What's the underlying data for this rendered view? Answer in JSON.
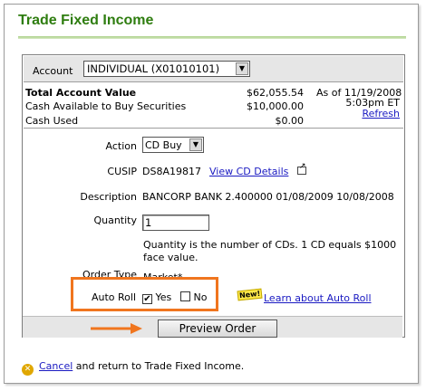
{
  "page": {
    "title": "Trade Fixed Income"
  },
  "account": {
    "label": "Account",
    "selected": "INDIVIDUAL (X01010101)"
  },
  "summary": {
    "total_label": "Total Account Value",
    "total_value": "$62,055.54",
    "cash_available_label": "Cash Available to Buy Securities",
    "cash_available_value": "$10,000.00",
    "cash_used_label": "Cash Used",
    "cash_used_value": "$0.00",
    "as_of": "As of 11/19/2008",
    "as_of_time": "5:03pm ET",
    "refresh_link": "Refresh"
  },
  "order": {
    "action_label": "Action",
    "action_value": "CD Buy",
    "cusip_label": "CUSIP",
    "cusip_value": "DS8A19817",
    "cusip_link": "View CD Details",
    "description_label": "Description",
    "description_value": "BANCORP BANK 2.400000 01/08/2009 10/08/2008",
    "quantity_label": "Quantity",
    "quantity_value": "1",
    "quantity_note_line1": "Quantity is the number of CDs. 1 CD equals $1000",
    "quantity_note_line2": "face value.",
    "order_type_label": "Order Type",
    "order_type_value": "Market*",
    "auto_roll_label": "Auto Roll",
    "auto_roll_yes": "Yes",
    "auto_roll_no": "No",
    "auto_roll_yes_checked": true,
    "auto_roll_no_checked": false,
    "new_badge": "New!",
    "auto_roll_link": "Learn about Auto Roll"
  },
  "buttons": {
    "preview": "Preview Order"
  },
  "footer": {
    "cancel_link": "Cancel",
    "cancel_text": " and return to Trade Fixed Income."
  },
  "colors": {
    "title": "#2e7d0f",
    "highlight": "#f0751e",
    "link": "#1a1ac2"
  }
}
